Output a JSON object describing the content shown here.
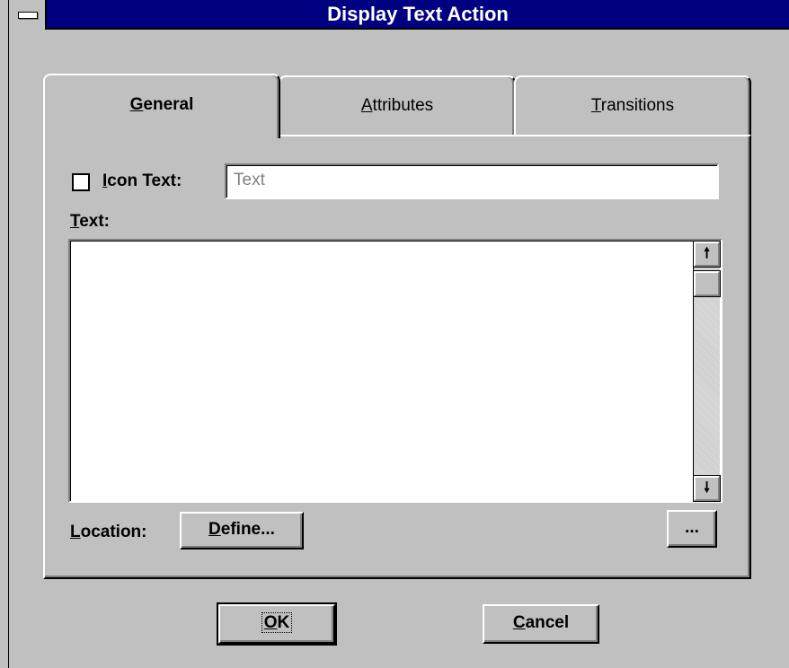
{
  "window": {
    "title": "Display Text Action"
  },
  "tabs": [
    {
      "label_pre": "",
      "label_acc": "G",
      "label_post": "eneral",
      "active": true
    },
    {
      "label_pre": "",
      "label_acc": "A",
      "label_post": "ttributes",
      "active": false
    },
    {
      "label_pre": "",
      "label_acc": "T",
      "label_post": "ransitions",
      "active": false
    }
  ],
  "general": {
    "icon_text": {
      "checked": false,
      "label_acc": "I",
      "label_rest": "con Text:",
      "value": "Text"
    },
    "text_label_acc": "T",
    "text_label_rest": "ext:",
    "text_value": "",
    "location_label_acc": "L",
    "location_label_rest": "ocation:",
    "define_acc": "D",
    "define_rest": "efine...",
    "ellipsis_label": "...",
    "scroll_up_glyph": "🠕",
    "scroll_down_glyph": "🠗"
  },
  "footer": {
    "ok_acc": "O",
    "ok_rest": "K",
    "cancel_acc": "C",
    "cancel_rest": "ancel"
  }
}
